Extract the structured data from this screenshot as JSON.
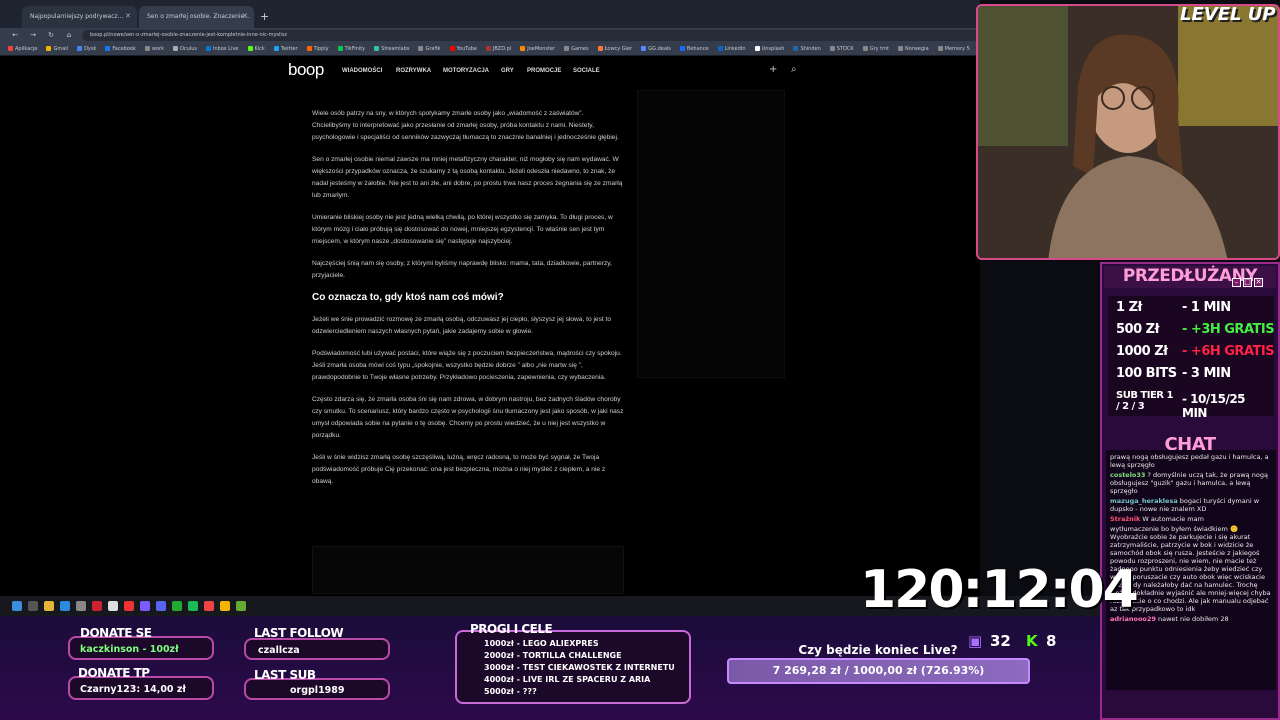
{
  "browser": {
    "tabs": [
      {
        "title": "Najpopularniejszy podrywacz..."
      },
      {
        "title": "Sen o zmarłej osobie. Znaczenie..."
      }
    ],
    "url": "boop.pl/nowe/sen-o-zmarlej-osobie-znaczenie-jest-kompletnie-inne-nic-myslisz",
    "bookmarks": [
      "Aplikacje",
      "Gmail",
      "Dysk",
      "Facebook",
      "work",
      "Oculus",
      "Inbox Live",
      "Kick",
      "Twitter",
      "Tipply",
      "TikFinity",
      "Streamlabs",
      "Grafik",
      "YouTube",
      "JBZD.pl",
      "JoeMonster",
      "Games",
      "Łowcy Gier",
      "GG.deals",
      "Behance",
      "LinkedIn",
      "Unsplash",
      "Shinden",
      "STOCK",
      "Gry tmt",
      "Norwegia",
      "Memory 5"
    ],
    "bookmark_colors": [
      "#e44",
      "#f5b400",
      "#4285f4",
      "#1877f2",
      "#888",
      "#aaa",
      "#0078d4",
      "#53fc18",
      "#1da1f2",
      "#ff6600",
      "#00c853",
      "#31c3a2",
      "#888",
      "#ff0000",
      "#aa3333",
      "#ff8800",
      "#888",
      "#ff7733",
      "#5588ff",
      "#1769ff",
      "#0a66c2",
      "#fff",
      "#2266aa",
      "#888",
      "#888",
      "#888",
      "#888"
    ]
  },
  "site": {
    "logo": "boop",
    "nav": [
      "WIADOMOŚCI",
      "ROZRYWKA",
      "MOTORYZACJA",
      "GRY",
      "PROMOCJE",
      "SOCIALE"
    ],
    "plus_icon": "+",
    "search_icon": "⌕"
  },
  "article": {
    "p1": "Wiele osób patrzy na sny, w których spotykamy zmarłe osoby jako „wiadomość z zaświatów”. Chcielibyśmy to interpretować jako przesłanie od zmarłej osoby, próba kontaktu z nami. Niestety, psychologowie i specjaliści od senników zazwyczaj tłumaczą to znacznie banalniej i jednocześnie głębiej.",
    "p2": "Sen o zmarłej osobie niemal zawsze ma mniej metafizyczny charakter, niż mogłoby się nam wydawać. W większości przypadków oznacza, że szukamy z tą osobą kontaktu. Jeżeli odeszła niedawno, to znak, że nadal jesteśmy w żałobie. Nie jest to ani złe, ani dobre, po prostu trwa nasz proces żegnania się ze zmarłą lub zmarłym.",
    "p3": "Umieranie bliskiej osoby nie jest jedną wielką chwilą, po której wszystko się zamyka. To długi proces, w którym mózg i ciało próbują się dostosować do nowej, mniejszej egzystencji. To właśnie sen jest tym miejscem, w którym nasze „dostosowanie się” następuje najszybciej.",
    "p4": "Najczęściej śnią nam się osoby, z którymi byliśmy naprawdę blisko: mama, tata, dziadkowie, partnerzy, przyjaciele.",
    "h2": "Co oznacza to, gdy ktoś nam coś mówi?",
    "p5": "Jeżeli we śnie prowadzić rozmowę ze zmarłą osobą, odczuwasz jej ciepło, słyszysz jej słowa, to jest to odzwierciedleniem naszych własnych pytań, jakie zadajemy sobie w głowie.",
    "p6": "Podświadomość lubi używać postaci, które wiąże się z poczuciem bezpieczeństwa, mądrości czy spokoju. Jeśli zmarła osoba mówi coś typu „spokojnie, wszystko będzie dobrze ” albo „nie martw się ”, prawdopodobnie to Twoje własne potrzeby. Przykładowo pocieszenia, zapewnienia, czy wybaczenia.",
    "p7": "Często zdarza się, że zmarła osoba śni się nam zdrowa, w dobrym nastroju, bez żadnych śladów choroby czy smutku. To scenariusz, który bardzo często w psychologii śnu tłumaczony jest jako sposób, w jaki nasz umysł odpowiada sobie na pytanie o tę osobę. Chcemy po prostu wiedzieć, że u niej jest wszystko w porządku.",
    "p8": "Jeśli w śnie widzisz zmarłą osobę szczęśliwą, lużną, wręcz radosną, to może być sygnał, że Twoja podświadomość próbuje Cię przekonać: ona jest bezpieczna, można o niej myśleć z ciepłem, a nie z obawą."
  },
  "stream": {
    "level_up": "LEVEL UP",
    "timer": "120:12:04",
    "przedluzany_title": "PRZEDŁUŻANY",
    "prices": [
      {
        "amount": "1 Zł",
        "value": "- 1 MIN",
        "color": "#ffffff"
      },
      {
        "amount": "500 Zł",
        "value": "- +3H GRATIS",
        "color": "#44ee44"
      },
      {
        "amount": "1000 Zł",
        "value": "- +6H GRATIS",
        "color": "#ff2244"
      },
      {
        "amount": "100 BITS",
        "value": "- 3 MIN",
        "color": "#ffffff"
      },
      {
        "amount": "SUB TIER 1 / 2 / 3",
        "value": "- 10/15/25 MIN",
        "color": "#ffffff"
      }
    ],
    "chat_title": "CHAT",
    "chat": [
      {
        "user": "",
        "text": "prawą nogą obsługujesz pedał gazu i hamulca, a lewą sprzęgło"
      },
      {
        "user": "costelo33",
        "text": "? domyślnie uczą tak, że prawą nogą obsługujesz \"guzik\" gazu i hamulca, a lewą sprzęgło"
      },
      {
        "user": "mazuga_heraklesa",
        "text": "bogaci turyści dymani w dupsko - nowe nie znalem XD"
      },
      {
        "user": "Strażnik",
        "text": "W automacie mam"
      },
      {
        "user": "",
        "text": "wytłumaczenie bo byłem świadkiem 🙂 Wyobraźcie sobie że parkujecie i się akurat zatrzymaliście, patrzycie w bok i widzicie że samochód obok się rusza. Jesteście z jakiegoś powodu rozproszeni, nie wiem, nie macie też żadnego punktu odniesienia żeby wiedzieć czy wy się poruszacie czy auto obok więc wciskacie gaz kiedy należałoby dać na hamulec. Trochę ciężko dokładnie wyjaśnić ale mniej-więcej chyba rozumiecie o co chodzi. Ale jak manualu odjebać az tak przypadkowo to idk"
      },
      {
        "user": "adrianooo29",
        "text": "nawet nie dobiłem 28"
      }
    ],
    "donate_title": "DONATE SE",
    "donate_value": "kaczkinson - 100zł",
    "donate_tp_title": "DONATE TP",
    "donate_tp_value": "Czarny123: 14,00 zł",
    "last_follow_title": "LAST FOLLOW",
    "last_follow_value": "czallcza",
    "last_sub_title": "LAST SUB",
    "last_sub_value": "orgpl1989",
    "goals_title": "PROGI I CELE",
    "goals": [
      "1000zł - LEGO ALIEXPRES",
      "2000zł - TORTILLA CHALLENGE",
      "3000zł - TEST CIEKAWOSTEK Z INTERNETU",
      "4000zł - LIVE IRL ZE SPACERU Z ARIA",
      "5000zł - ???"
    ],
    "question": "Czy będzie koniec Live?",
    "goal_progress": "7 269,28 zł / 1000,00 zł (726.93%)",
    "viewers": "32",
    "kick_count": "8"
  },
  "colors": {
    "accent": "#b84aa8",
    "pink_text": "#ff9dd6"
  }
}
